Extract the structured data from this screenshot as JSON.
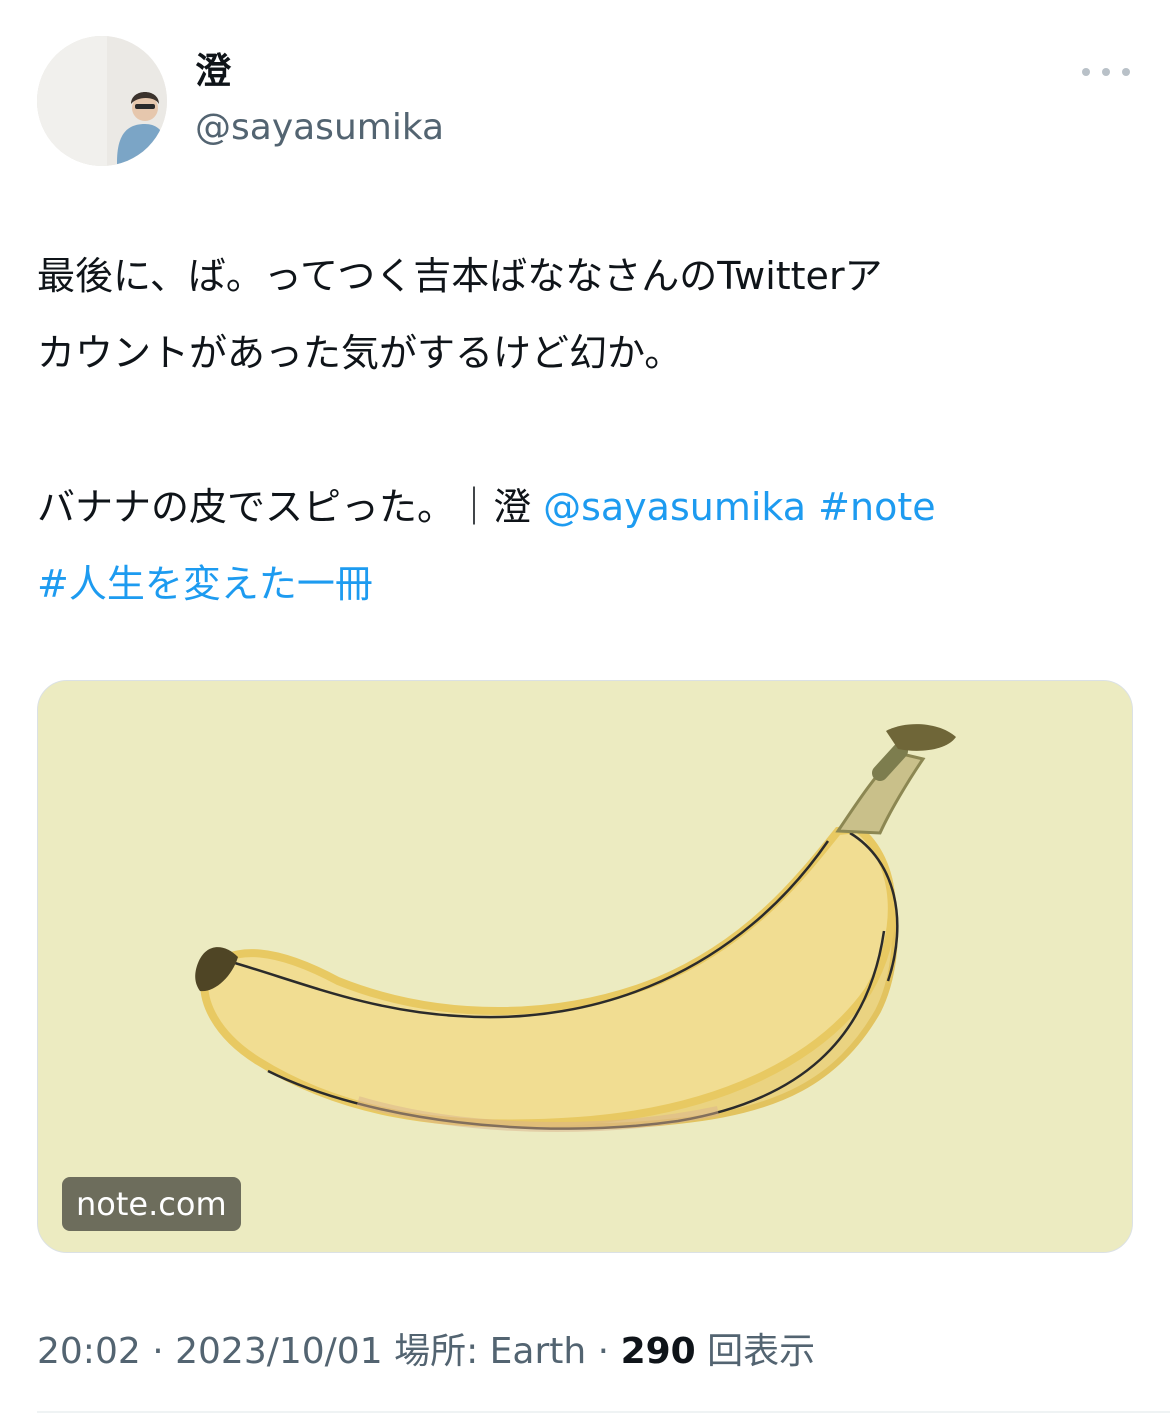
{
  "author": {
    "display_name": "澄",
    "handle": "@sayasumika"
  },
  "tweet": {
    "line1": "最後に、ば。ってつく吉本ばななさんのTwitterア",
    "line2": "カウントがあった気がするけど幻か。",
    "line3_text": "バナナの皮でスピった。｜澄 ",
    "mention": "@sayasumika",
    "hashtag_note": "#note",
    "hashtag_book": "#人生を変えた一冊"
  },
  "card": {
    "domain": "note.com"
  },
  "meta": {
    "time": "20:02",
    "date": "2023/10/01",
    "location_label": "場所:",
    "location": "Earth",
    "views_count": "290",
    "views_label": "回表示",
    "separator": "·"
  },
  "colors": {
    "link": "#1d9bf0",
    "card_background": "#ecebc1",
    "banana_fill": "#f1dd92"
  }
}
